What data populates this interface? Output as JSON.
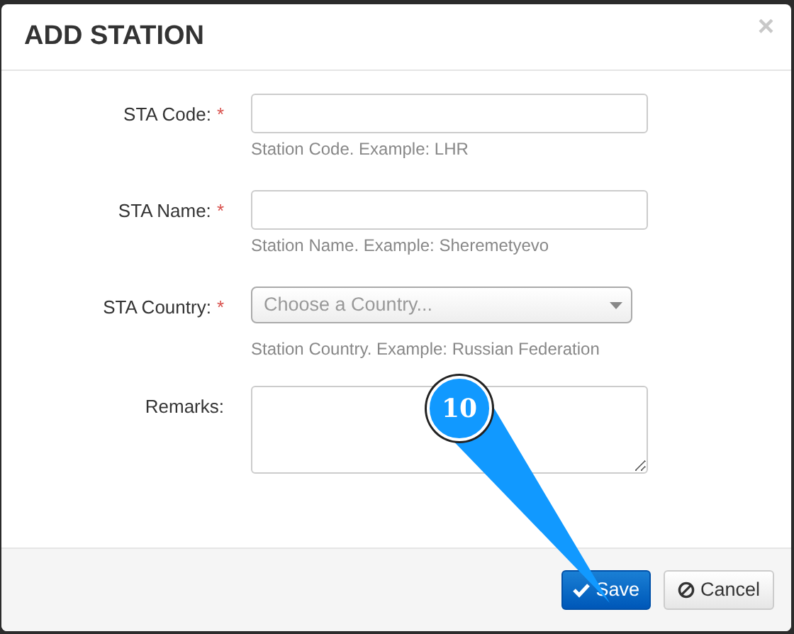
{
  "dialog": {
    "title": "ADD STATION",
    "close": "×"
  },
  "fields": [
    {
      "kind": "input",
      "label": "STA Code:",
      "required_marker": "*",
      "help": "Station Code. Example: LHR"
    },
    {
      "kind": "input",
      "label": "STA Name:",
      "required_marker": "*",
      "help": "Station Name. Example: Sheremetyevo"
    },
    {
      "kind": "select",
      "label": "STA Country:",
      "required_marker": "*",
      "placeholder": "Choose a Country...",
      "help": "Station Country. Example: Russian Federation"
    },
    {
      "kind": "textarea",
      "label": "Remarks:"
    }
  ],
  "buttons": [
    {
      "kind": "primary",
      "label": "Save"
    },
    {
      "kind": "default",
      "label": "Cancel"
    }
  ],
  "callout": {
    "number": "10"
  }
}
